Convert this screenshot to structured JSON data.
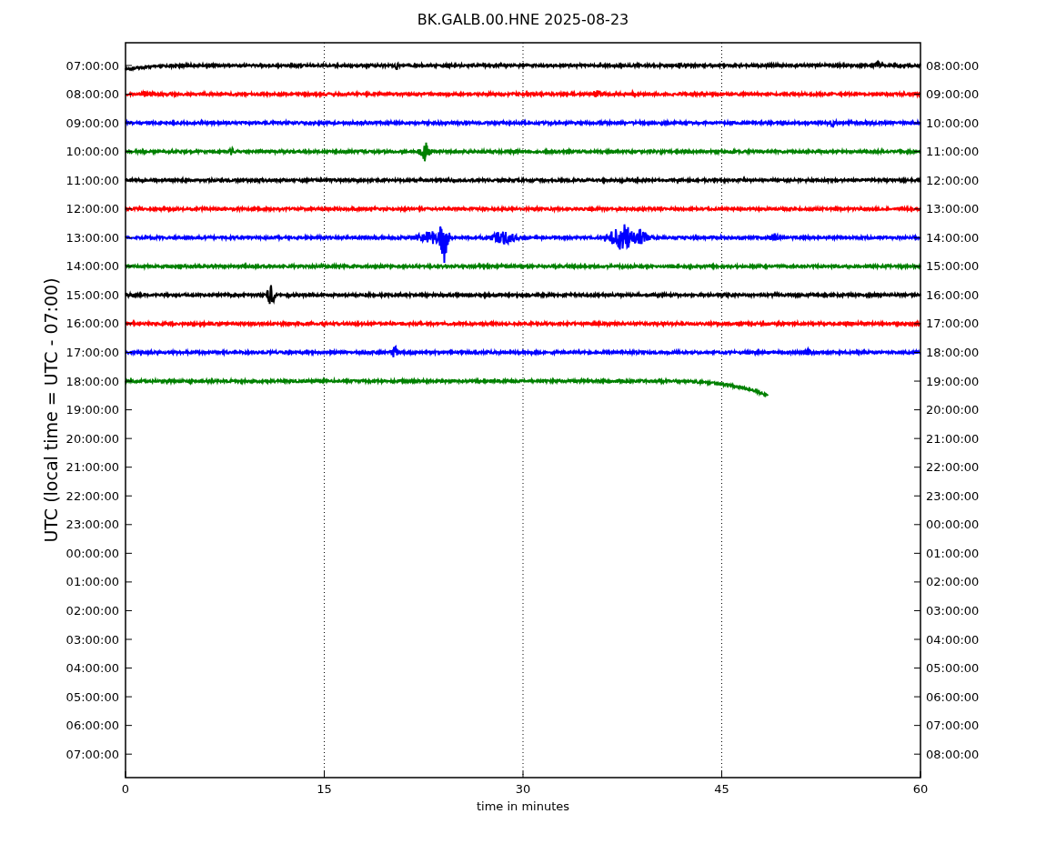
{
  "title": "BK.GALB.00.HNE 2025-08-23",
  "ylabel": "UTC (local time = UTC - 07:00)",
  "xlabel": "time in minutes",
  "xticks": [
    "0",
    "15",
    "30",
    "45",
    "60"
  ],
  "left_labels": [
    "07:00:00",
    "08:00:00",
    "09:00:00",
    "10:00:00",
    "11:00:00",
    "12:00:00",
    "13:00:00",
    "14:00:00",
    "15:00:00",
    "16:00:00",
    "17:00:00",
    "18:00:00",
    "19:00:00",
    "20:00:00",
    "21:00:00",
    "22:00:00",
    "23:00:00",
    "00:00:00",
    "01:00:00",
    "02:00:00",
    "03:00:00",
    "04:00:00",
    "05:00:00",
    "06:00:00",
    "07:00:00"
  ],
  "right_labels": [
    "08:00:00",
    "09:00:00",
    "10:00:00",
    "11:00:00",
    "12:00:00",
    "13:00:00",
    "14:00:00",
    "15:00:00",
    "16:00:00",
    "17:00:00",
    "18:00:00",
    "19:00:00",
    "20:00:00",
    "21:00:00",
    "22:00:00",
    "23:00:00",
    "00:00:00",
    "01:00:00",
    "02:00:00",
    "03:00:00",
    "04:00:00",
    "05:00:00",
    "06:00:00",
    "07:00:00",
    "08:00:00"
  ],
  "traces": [
    {
      "color": "#000000",
      "kind": "full"
    },
    {
      "color": "#ff0000",
      "kind": "full"
    },
    {
      "color": "#0000ff",
      "kind": "full"
    },
    {
      "color": "#008000",
      "kind": "full"
    },
    {
      "color": "#000000",
      "kind": "full"
    },
    {
      "color": "#ff0000",
      "kind": "full"
    },
    {
      "color": "#0000ff",
      "kind": "full"
    },
    {
      "color": "#008000",
      "kind": "full"
    },
    {
      "color": "#000000",
      "kind": "full"
    },
    {
      "color": "#ff0000",
      "kind": "full"
    },
    {
      "color": "#0000ff",
      "kind": "full"
    },
    {
      "color": "#008000",
      "kind": "partial"
    }
  ]
}
